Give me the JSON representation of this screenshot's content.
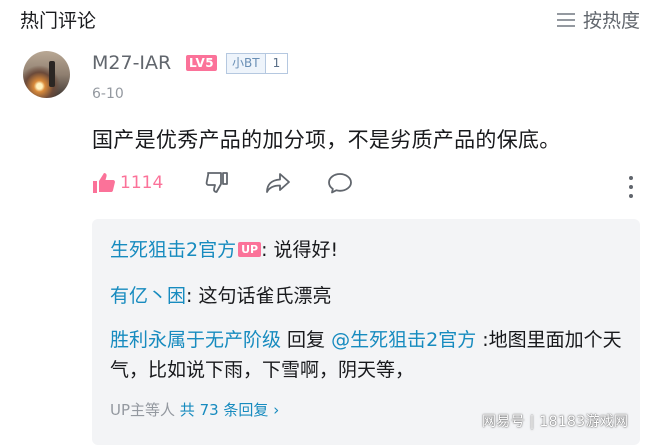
{
  "header": {
    "title": "热门评论",
    "sort_label": "按热度"
  },
  "comment": {
    "username": "M27-IAR",
    "level_badge": "LV5",
    "medal_name": "小BT",
    "medal_level": "1",
    "date": "6-10",
    "content": "国产是优秀产品的加分项，不是劣质产品的保底。",
    "like_count": "1114"
  },
  "replies": [
    {
      "author": "生死狙击2官方",
      "up_badge": "UP",
      "text": ": 说得好!"
    },
    {
      "author": "有亿丶困",
      "text": ": 这句话雀氏漂亮"
    },
    {
      "author": "胜利永属于无产阶级",
      "reply_word": " 回复 ",
      "mention": "@生死狙击2官方",
      "text": " :地图里面加个天气，比如说下雨，下雪啊，阴天等，"
    }
  ],
  "more_replies": {
    "prefix": "UP主等人 ",
    "count_text": "共 73 条回复",
    "chevron": " ›"
  },
  "watermark": "网易号 | 18183游戏网",
  "colors": {
    "accent_pink": "#fb7299",
    "link_blue": "#178bbf",
    "muted": "#9499a0"
  }
}
